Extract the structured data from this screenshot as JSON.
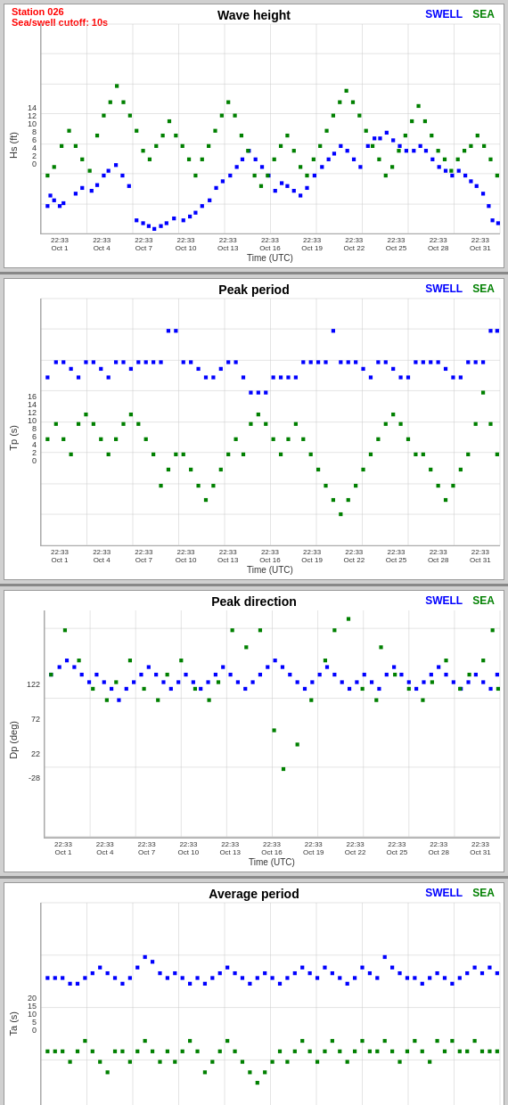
{
  "station": {
    "id": "Station 026",
    "cutoff": "Sea/swell cutoff: 10s"
  },
  "xLabels": [
    "22:33\nOct 1",
    "22:33\nOct 4",
    "22:33\nOct 7",
    "22:33\nOct 10",
    "22:33\nOct 13",
    "22:33\nOct 16",
    "22:33\nOct 19",
    "22:33\nOct 22",
    "22:33\nOct 25",
    "22:33\nOct 28",
    "22:33\nOct 31"
  ],
  "charts": [
    {
      "title": "Wave height",
      "yLabel": "Hs (ft)",
      "yTicks": [
        "14",
        "12",
        "10",
        "8",
        "6",
        "4",
        "2",
        "0"
      ],
      "yMax": 14,
      "yMin": 0
    },
    {
      "title": "Peak period",
      "yLabel": "Tp (s)",
      "yTicks": [
        "16",
        "14",
        "12",
        "10",
        "8",
        "6",
        "4",
        "2",
        "0"
      ],
      "yMax": 16,
      "yMin": 0
    },
    {
      "title": "Peak direction",
      "yLabel": "Dp (deg)",
      "yTicks": [
        "122",
        "72",
        "22",
        "-28"
      ],
      "yMax": 135,
      "yMin": -35
    },
    {
      "title": "Average period",
      "yLabel": "Ta (s)",
      "yTicks": [
        "20",
        "15",
        "10",
        "5",
        "0"
      ],
      "yMax": 20,
      "yMin": 0
    }
  ],
  "legend": {
    "swell": "SWELL",
    "sea": "SEA"
  },
  "xAxisTitle": "Time (UTC)"
}
